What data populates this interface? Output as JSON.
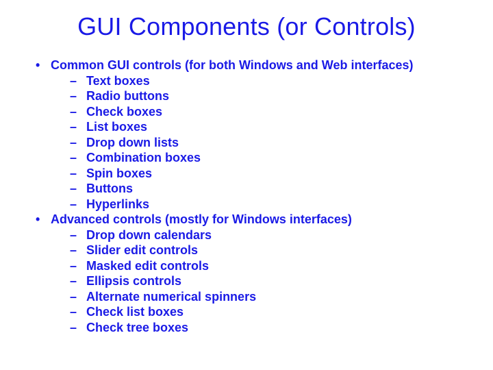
{
  "title": "GUI Components (or Controls)",
  "sections": [
    {
      "heading": "Common GUI controls (for both Windows and Web interfaces)",
      "items": [
        "Text boxes",
        "Radio buttons",
        "Check boxes",
        "List boxes",
        "Drop down lists",
        "Combination boxes",
        "Spin boxes",
        "Buttons",
        "Hyperlinks"
      ]
    },
    {
      "heading": "Advanced controls (mostly for Windows interfaces)",
      "items": [
        "Drop down calendars",
        "Slider edit controls",
        "Masked edit controls",
        "Ellipsis controls",
        "Alternate numerical spinners",
        "Check list boxes",
        "Check tree boxes"
      ]
    }
  ]
}
